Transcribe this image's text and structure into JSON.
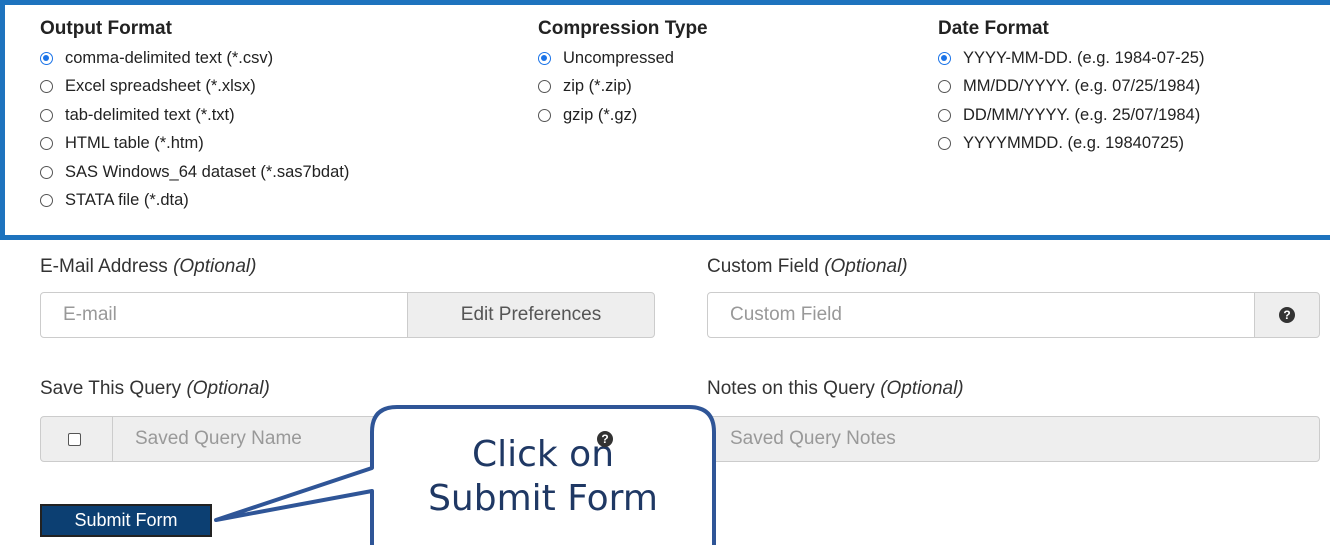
{
  "output_format": {
    "title": "Output Format",
    "options": [
      {
        "label": "comma-delimited text (*.csv)",
        "checked": true
      },
      {
        "label": "Excel spreadsheet (*.xlsx)",
        "checked": false
      },
      {
        "label": "tab-delimited text (*.txt)",
        "checked": false
      },
      {
        "label": "HTML table (*.htm)",
        "checked": false
      },
      {
        "label": "SAS Windows_64 dataset (*.sas7bdat)",
        "checked": false
      },
      {
        "label": "STATA file (*.dta)",
        "checked": false
      }
    ]
  },
  "compression_type": {
    "title": "Compression Type",
    "options": [
      {
        "label": "Uncompressed",
        "checked": true
      },
      {
        "label": "zip (*.zip)",
        "checked": false
      },
      {
        "label": "gzip (*.gz)",
        "checked": false
      }
    ]
  },
  "date_format": {
    "title": "Date Format",
    "options": [
      {
        "label": "YYYY-MM-DD. (e.g. 1984-07-25)",
        "checked": true
      },
      {
        "label": "MM/DD/YYYY. (e.g. 07/25/1984)",
        "checked": false
      },
      {
        "label": "DD/MM/YYYY. (e.g. 25/07/1984)",
        "checked": false
      },
      {
        "label": "YYYYMMDD. (e.g. 19840725)",
        "checked": false
      }
    ]
  },
  "email": {
    "label": "E-Mail Address",
    "optional": "(Optional)",
    "placeholder": "E-mail",
    "button": "Edit Preferences"
  },
  "custom_field": {
    "label": "Custom Field",
    "optional": "(Optional)",
    "placeholder": "Custom Field"
  },
  "save_query": {
    "label": "Save This Query",
    "optional": "(Optional)",
    "placeholder": "Saved Query Name"
  },
  "notes": {
    "label": "Notes on this Query",
    "optional": "(Optional)",
    "placeholder": "Saved Query Notes"
  },
  "submit_label": "Submit Form",
  "callout": {
    "line1": "Click on",
    "line2": "Submit Form"
  },
  "colors": {
    "frame": "#1e73be",
    "submit": "#0c3f72",
    "callout_stroke": "#2f5597",
    "callout_text": "#1f3864"
  }
}
